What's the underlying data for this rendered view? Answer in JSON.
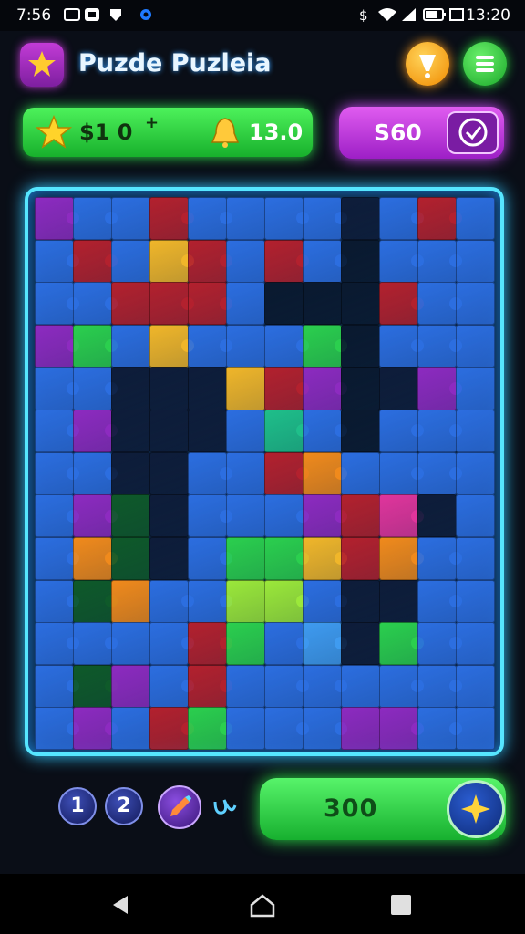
{
  "status_bar": {
    "time_left": "7:56",
    "time_right": "13:20"
  },
  "header": {
    "title": "Puzde Puzleia",
    "hint_icon": "exclamation-icon",
    "menu_icon": "hamburger-menu-icon"
  },
  "score_bar": {
    "score_text": "$1 0",
    "score_suffix": "+",
    "moves_text": "13.0"
  },
  "coins": {
    "value": "S60"
  },
  "bottom": {
    "btn1": "1",
    "btn2": "2",
    "play_value": "300"
  },
  "colors": {
    "accent_green": "#2fe04a",
    "accent_purple": "#d24cff",
    "board_border": "#56e6ff",
    "background": "#0a0e17"
  },
  "board": {
    "cols": 12,
    "rows": 13,
    "tiles": [
      "m",
      "b",
      "b",
      "r",
      "b",
      "b",
      "b",
      "b",
      "k",
      "b",
      "r",
      "b",
      "b",
      "r",
      "b",
      "y",
      "r",
      "b",
      "r",
      "b",
      "n",
      "b",
      "b",
      "b",
      "b",
      "b",
      "r",
      "r",
      "r",
      "b",
      "n",
      "n",
      "n",
      "r",
      "b",
      "b",
      "m",
      "g",
      "b",
      "y",
      "b",
      "b",
      "b",
      "g",
      "n",
      "b",
      "b",
      "b",
      "b",
      "b",
      "k",
      "k",
      "k",
      "y",
      "r",
      "m",
      "n",
      "k",
      "m",
      "b",
      "b",
      "m",
      "k",
      "k",
      "k",
      "b",
      "t",
      "b",
      "n",
      "b",
      "b",
      "b",
      "b",
      "b",
      "k",
      "k",
      "b",
      "b",
      "r",
      "o",
      "b",
      "b",
      "b",
      "b",
      "b",
      "m",
      "d",
      "k",
      "b",
      "b",
      "b",
      "m",
      "r",
      "p",
      "k",
      "b",
      "b",
      "o",
      "d",
      "k",
      "b",
      "g",
      "g",
      "y",
      "r",
      "o",
      "b",
      "b",
      "b",
      "d",
      "o",
      "b",
      "b",
      "G",
      "G",
      "b",
      "k",
      "k",
      "b",
      "b",
      "b",
      "b",
      "b",
      "b",
      "r",
      "g",
      "b",
      "l",
      "k",
      "g",
      "b",
      "b",
      "b",
      "d",
      "m",
      "b",
      "r",
      "b",
      "b",
      "b",
      "b",
      "b",
      "b",
      "b",
      "b",
      "m",
      "b",
      "r",
      "g",
      "b",
      "b",
      "b",
      "m",
      "m",
      "b",
      "b"
    ]
  }
}
